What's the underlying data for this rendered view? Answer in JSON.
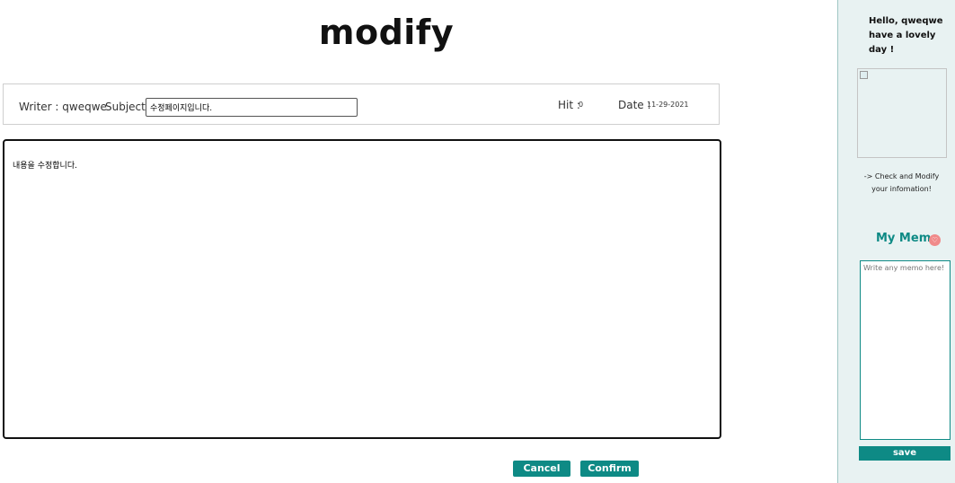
{
  "page": {
    "title": "modify"
  },
  "post": {
    "writer_label": "Writer : qweqwe",
    "subject_label": "Subject :",
    "subject_value": "수정페이지입니다.",
    "hit_label": "Hit :",
    "hit_value": "0",
    "date_label": "Date :",
    "date_value": "11-29-2021",
    "content_value": "내용을 수정합니다."
  },
  "actions": {
    "cancel_label": "Cancel",
    "confirm_label": "Confirm"
  },
  "sidebar": {
    "greeting_line1": "Hello, qweqwe",
    "greeting_line2": "have a lovely day !",
    "check_line1": "-> Check and Modify",
    "check_line2": "your infomation!",
    "memo_title": "My Memo",
    "memo_icon": "heart-icon",
    "memo_placeholder": "Write any memo here!",
    "save_label": "save"
  },
  "colors": {
    "accent": "#0e8a85",
    "sidebar_bg": "#e8f2f2",
    "heart": "#f08a8a"
  }
}
